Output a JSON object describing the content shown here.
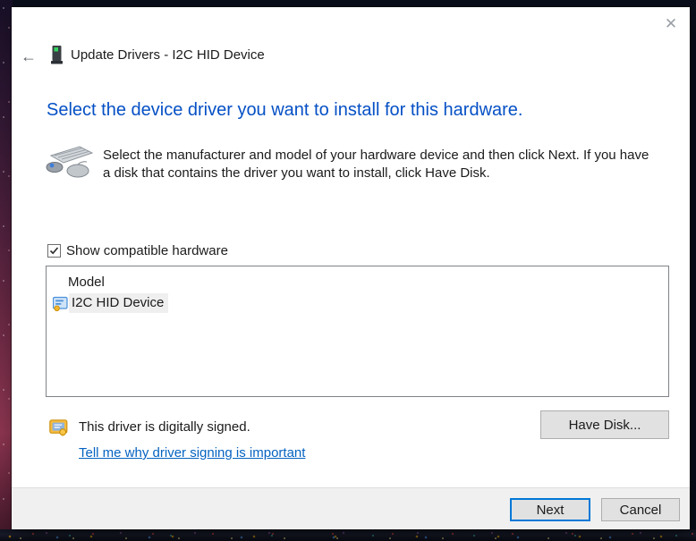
{
  "window": {
    "title": "Update Drivers - I2C HID Device"
  },
  "icons": {
    "back": "←",
    "close": "✕"
  },
  "heading": "Select the device driver you want to install for this hardware.",
  "instruction": "Select the manufacturer and model of your hardware device and then click Next. If you have a disk that contains the driver you want to install, click Have Disk.",
  "checkbox": {
    "label": "Show compatible hardware",
    "checked": true
  },
  "model_list": {
    "header": "Model",
    "items": [
      {
        "label": "I2C HID Device",
        "selected": true
      }
    ]
  },
  "signing": {
    "status": "This driver is digitally signed.",
    "link": "Tell me why driver signing is important"
  },
  "buttons": {
    "have_disk": "Have Disk...",
    "next": "Next",
    "cancel": "Cancel"
  },
  "colors": {
    "heading": "#0550c5",
    "link": "#0563c1",
    "accent": "#0078d7",
    "footer_bg": "#f0f0f0",
    "selection_bg": "#efefef"
  }
}
